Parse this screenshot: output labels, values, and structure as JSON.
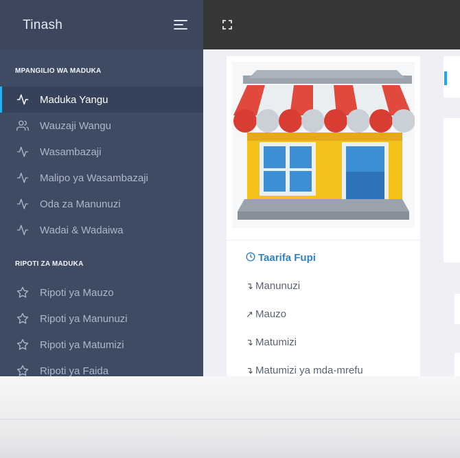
{
  "brand": {
    "name": "Tinash"
  },
  "sidebar": {
    "sections": [
      {
        "title": "MPANGILIO WA MADUKA",
        "items": [
          {
            "label": "Maduka Yangu",
            "icon": "activity-icon",
            "active": true
          },
          {
            "label": "Wauzaji Wangu",
            "icon": "users-icon",
            "active": false
          },
          {
            "label": "Wasambazaji",
            "icon": "activity-icon",
            "active": false
          },
          {
            "label": "Malipo ya Wasambazaji",
            "icon": "activity-icon",
            "active": false
          },
          {
            "label": "Oda za Manunuzi",
            "icon": "activity-icon",
            "active": false
          },
          {
            "label": "Wadai & Wadaiwa",
            "icon": "activity-icon",
            "active": false
          }
        ]
      },
      {
        "title": "RIPOTI ZA MADUKA",
        "items": [
          {
            "label": "Ripoti ya Mauzo",
            "icon": "star-icon",
            "active": false
          },
          {
            "label": "Ripoti ya Manunuzi",
            "icon": "star-icon",
            "active": false
          },
          {
            "label": "Ripoti ya Matumizi",
            "icon": "star-icon",
            "active": false
          },
          {
            "label": "Ripoti ya Faida",
            "icon": "star-icon",
            "active": false
          }
        ]
      }
    ]
  },
  "topbar": {
    "fullscreen_icon": "fullscreen-icon"
  },
  "card": {
    "image_icon": "shop-icon",
    "links": [
      {
        "label": "Taarifa Fupi",
        "icon": "clock-icon",
        "primary": true
      },
      {
        "label": "Manunuzi",
        "icon": "arrow-down-right-icon",
        "glyph": "↴"
      },
      {
        "label": "Mauzo",
        "icon": "arrow-up-right-icon",
        "glyph": "↗"
      },
      {
        "label": "Matumizi",
        "icon": "arrow-down-right-icon",
        "glyph": "↴"
      },
      {
        "label": "Matumizi ya mda-mrefu",
        "icon": "arrow-down-right-icon",
        "glyph": "↴"
      }
    ]
  },
  "colors": {
    "sidebar_bg": "#3f4b63",
    "topbar_bg": "#373737",
    "accent": "#2ab0ee",
    "link_primary": "#2f82c5"
  }
}
